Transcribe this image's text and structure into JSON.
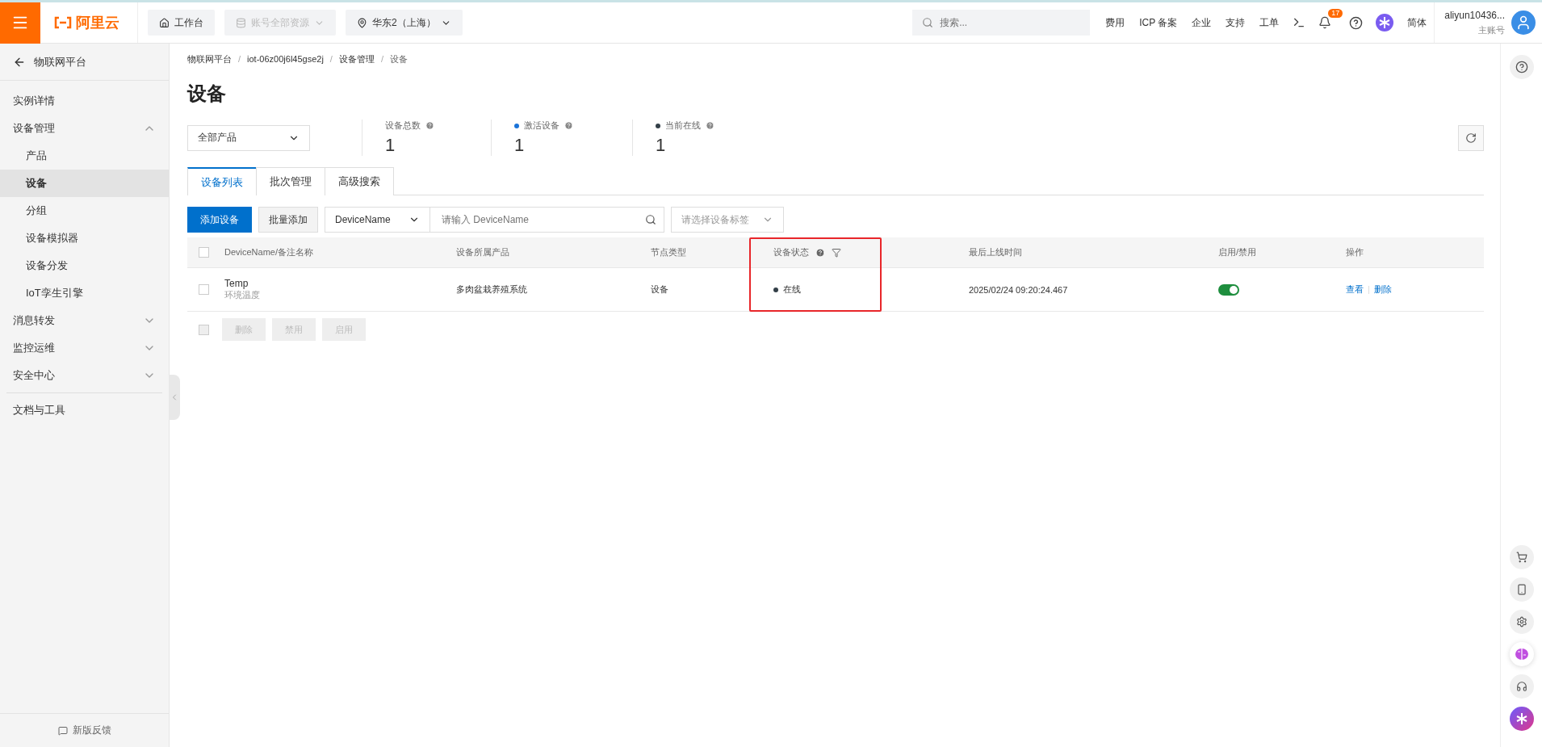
{
  "topbar": {
    "logo": "阿里云",
    "workbench": "工作台",
    "resources": {
      "label": "账号全部资源",
      "disabled": true
    },
    "region": "华东2（上海）",
    "search": {
      "placeholder": "搜索..."
    },
    "links": [
      "费用",
      "ICP 备案",
      "企业",
      "支持",
      "工单"
    ],
    "notifications": "17",
    "language": "简体",
    "user": {
      "name": "aliyun10436...",
      "role": "主账号"
    }
  },
  "sidebar": {
    "back": "物联网平台",
    "items": [
      {
        "label": "实例详情",
        "selected": false
      },
      {
        "label": "设备管理",
        "selected": false,
        "expanded": true,
        "children": [
          {
            "label": "产品",
            "selected": false
          },
          {
            "label": "设备",
            "selected": true
          },
          {
            "label": "分组",
            "selected": false
          },
          {
            "label": "设备模拟器",
            "selected": false
          },
          {
            "label": "设备分发",
            "selected": false
          },
          {
            "label": "IoT孪生引擎",
            "selected": false
          }
        ]
      },
      {
        "label": "消息转发",
        "selected": false,
        "expanded": false
      },
      {
        "label": "监控运维",
        "selected": false,
        "expanded": false
      },
      {
        "label": "安全中心",
        "selected": false,
        "expanded": false
      },
      {
        "label": "文档与工具",
        "selected": false
      }
    ],
    "feedback": "新版反馈"
  },
  "breadcrumb": {
    "separator": "/",
    "items": [
      "物联网平台",
      "iot-06z00j6l45gse2j",
      "设备管理",
      "设备"
    ]
  },
  "page_title": "设备",
  "product_select": "全部产品",
  "stats": [
    {
      "label": "设备总数",
      "value": "1"
    },
    {
      "label": "激活设备",
      "value": "1",
      "color": "#1a73d9"
    },
    {
      "label": "当前在线",
      "value": "1",
      "color": "#333f48"
    }
  ],
  "tabs": [
    {
      "label": "设备列表",
      "selected": true
    },
    {
      "label": "批次管理",
      "selected": false
    },
    {
      "label": "高级搜索",
      "selected": false
    }
  ],
  "toolbar": {
    "add": "添加设备",
    "batch_add": "批量添加",
    "field_select": "DeviceName",
    "search": {
      "placeholder": "请输入 DeviceName"
    },
    "tag_select": {
      "placeholder": "请选择设备标签"
    }
  },
  "table": {
    "select_all": {
      "checked": false
    },
    "columns": [
      {
        "label": "DeviceName/备注名称"
      },
      {
        "label": "设备所属产品"
      },
      {
        "label": "节点类型"
      },
      {
        "label": "设备状态",
        "highlighted": true
      },
      {
        "label": "最后上线时间"
      },
      {
        "label": "启用/禁用"
      },
      {
        "label": "操作"
      }
    ],
    "rows": [
      {
        "checked": false,
        "name": "Temp",
        "note": "环境温度",
        "product": "多肉盆栽养殖系统",
        "node_type": "设备",
        "status": "在线",
        "last_online": "2025/02/24 09:20:24.467",
        "enabled": true,
        "actions": [
          "查看",
          "删除"
        ]
      }
    ],
    "bulk_select": {
      "checked": false,
      "disabled": true
    },
    "bulk_actions": [
      {
        "label": "删除",
        "disabled": true
      },
      {
        "label": "禁用",
        "disabled": true
      },
      {
        "label": "启用",
        "disabled": true
      }
    ]
  }
}
